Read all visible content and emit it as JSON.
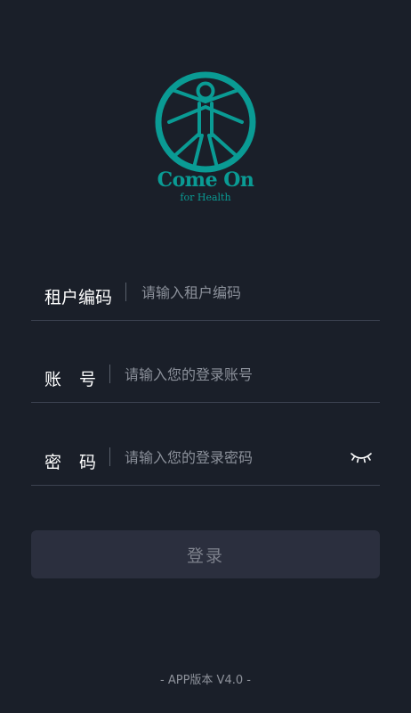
{
  "logo": {
    "title": "Come On",
    "subtitle": "for Health",
    "icon": "vitruvian-figure-icon",
    "color": "#0a9b94"
  },
  "form": {
    "tenant": {
      "label": "租户编码",
      "placeholder": "请输入租户编码",
      "value": ""
    },
    "account": {
      "label": "账号",
      "placeholder": "请输入您的登录账号",
      "value": ""
    },
    "password": {
      "label": "密码",
      "placeholder": "请输入您的登录密码",
      "value": "",
      "toggle_icon": "eye-closed-icon"
    }
  },
  "login_button": {
    "label": "登录"
  },
  "version": "- APP版本 V4.0 -",
  "colors": {
    "background": "#1a1f29",
    "accent": "#0a9b94",
    "button": "#2b2f3e",
    "divider": "#3c4250"
  }
}
